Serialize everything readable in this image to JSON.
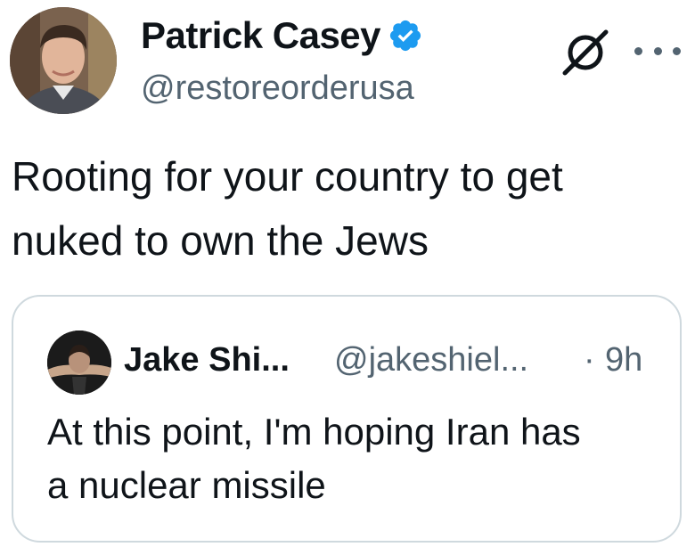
{
  "tweet": {
    "author": {
      "display_name": "Patrick Casey",
      "handle": "@restoreorderusa",
      "verified": true,
      "avatar_icon": "profile-photo"
    },
    "text_line1": "Rooting for your country to get",
    "text_line2": "nuked to own the Jews",
    "actions": {
      "grok_icon": "grok-icon",
      "more_icon": "more-dots-icon"
    }
  },
  "quoted_tweet": {
    "author": {
      "display_name": "Jake Shi...",
      "handle": "@jakeshiel...",
      "separator": "·",
      "time": "9h",
      "avatar_icon": "profile-photo"
    },
    "text_line1": "At this point, I'm hoping Iran has",
    "text_line2": "a nuclear missile"
  },
  "colors": {
    "text_primary": "#0f1419",
    "text_secondary": "#536471",
    "verified_blue": "#1d9bf0",
    "border": "#cfd9de"
  }
}
